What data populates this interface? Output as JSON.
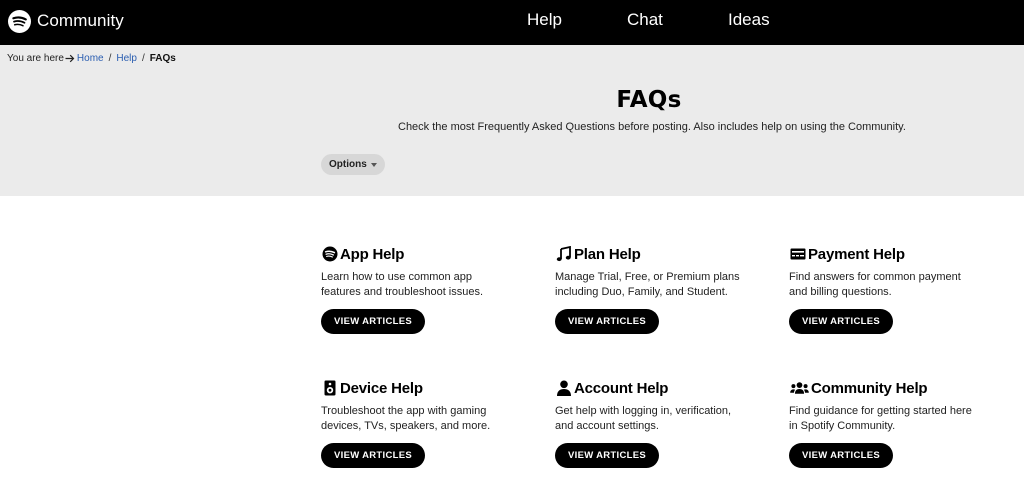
{
  "topbar": {
    "brand": "Community",
    "nav": [
      "Help",
      "Chat",
      "Ideas"
    ]
  },
  "breadcrumb": {
    "prefix": "You are here",
    "home": "Home",
    "help": "Help",
    "sep": "/",
    "current": "FAQs"
  },
  "hero": {
    "title": "FAQs",
    "description": "Check the most Frequently Asked Questions before posting. Also includes help on using the Community.",
    "options_label": "Options"
  },
  "cards": [
    {
      "title": "App Help",
      "icon": "spotify-icon",
      "description": "Learn how to use common app features and troubleshoot issues.",
      "button": "VIEW ARTICLES"
    },
    {
      "title": "Plan Help",
      "icon": "music-note-icon",
      "description": "Manage Trial, Free, or Premium plans including Duo, Family, and Student.",
      "button": "VIEW ARTICLES"
    },
    {
      "title": "Payment Help",
      "icon": "payment-card-icon",
      "description": "Find answers for common payment and billing questions.",
      "button": "VIEW ARTICLES"
    },
    {
      "title": "Device Help",
      "icon": "speaker-icon",
      "description": "Troubleshoot the app with gaming devices, TVs, speakers, and more.",
      "button": "VIEW ARTICLES"
    },
    {
      "title": "Account Help",
      "icon": "user-icon",
      "description": "Get help with logging in, verification, and account settings.",
      "button": "VIEW ARTICLES"
    },
    {
      "title": "Community Help",
      "icon": "users-icon",
      "description": "Find guidance for getting started here in Spotify Community.",
      "button": "VIEW ARTICLES"
    }
  ],
  "colors": {
    "topbar_bg": "#000000",
    "hero_bg": "#ebebeb",
    "link": "#2a5db0",
    "button_bg": "#000000"
  }
}
